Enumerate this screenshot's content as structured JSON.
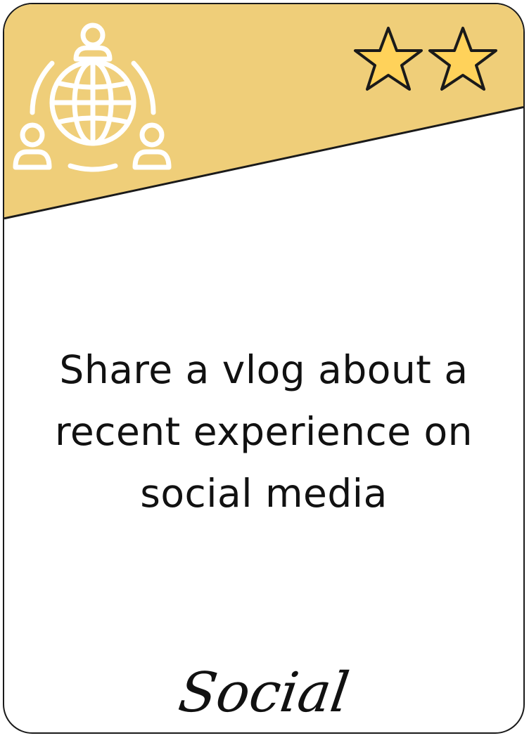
{
  "card": {
    "prompt": "Share a vlog about a recent experience on social media",
    "category": "Social",
    "stars": 2,
    "header_color": "#EFCE79",
    "star_fill": "#FFD25A",
    "icon": "social-network-globe-icon"
  }
}
